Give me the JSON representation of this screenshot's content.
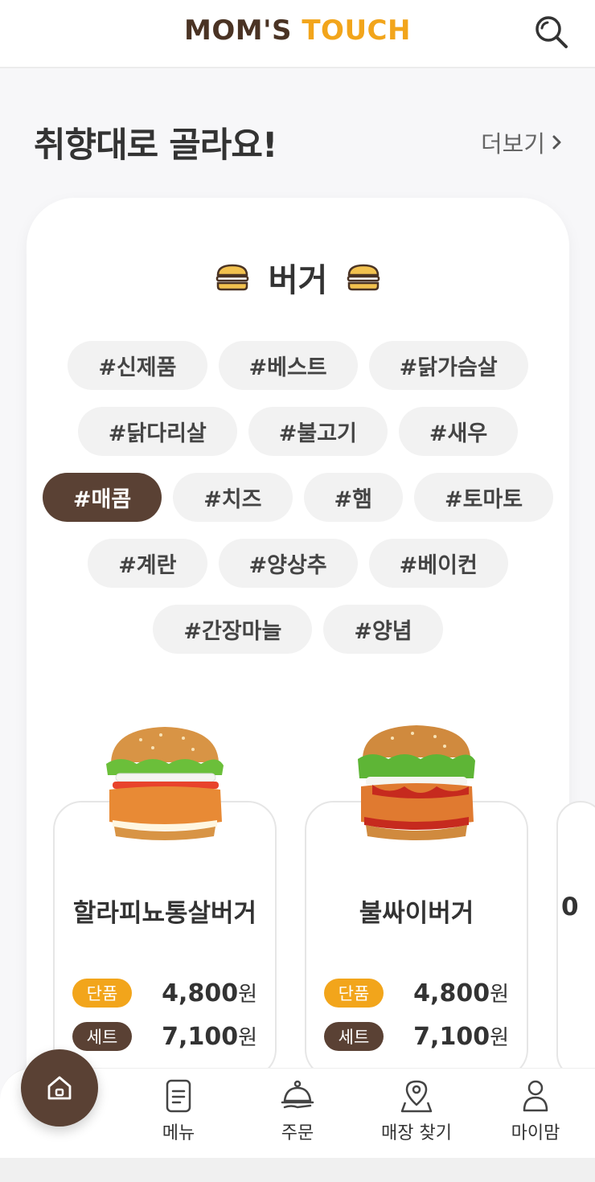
{
  "header": {
    "logo_part1": "MOM'S",
    "logo_part2": "TOUCH",
    "search_icon": "search-icon"
  },
  "section": {
    "title": "취향대로 골라요!",
    "more_label": "더보기"
  },
  "category": {
    "name": "버거",
    "icon": "burger-icon"
  },
  "tags": [
    [
      "#신제품",
      "#베스트",
      "#닭가슴살"
    ],
    [
      "#닭다리살",
      "#불고기",
      "#새우"
    ],
    [
      "#매콤",
      "#치즈",
      "#햄",
      "#토마토"
    ],
    [
      "#계란",
      "#양상추",
      "#베이컨"
    ],
    [
      "#간장마늘",
      "#양념"
    ]
  ],
  "active_tag": "#매콤",
  "products": [
    {
      "name": "할라피뇨통살버거",
      "single_label": "단품",
      "single_price": "4,800",
      "set_label": "세트",
      "set_price": "7,100",
      "currency": "원"
    },
    {
      "name": "불싸이버거",
      "single_label": "단품",
      "single_price": "4,800",
      "set_label": "세트",
      "set_price": "7,100",
      "currency": "원"
    }
  ],
  "peek_product": {
    "name_fragment": "0"
  },
  "nav": {
    "home_icon": "home-icon",
    "items": [
      {
        "label": "메뉴",
        "icon": "menu-icon"
      },
      {
        "label": "주문",
        "icon": "order-icon"
      },
      {
        "label": "매장 찾기",
        "icon": "location-icon"
      },
      {
        "label": "마이맘",
        "icon": "user-icon"
      }
    ]
  },
  "colors": {
    "brand_brown": "#5a4134",
    "brand_orange": "#f2a51b",
    "logo_brown": "#4a3324"
  }
}
